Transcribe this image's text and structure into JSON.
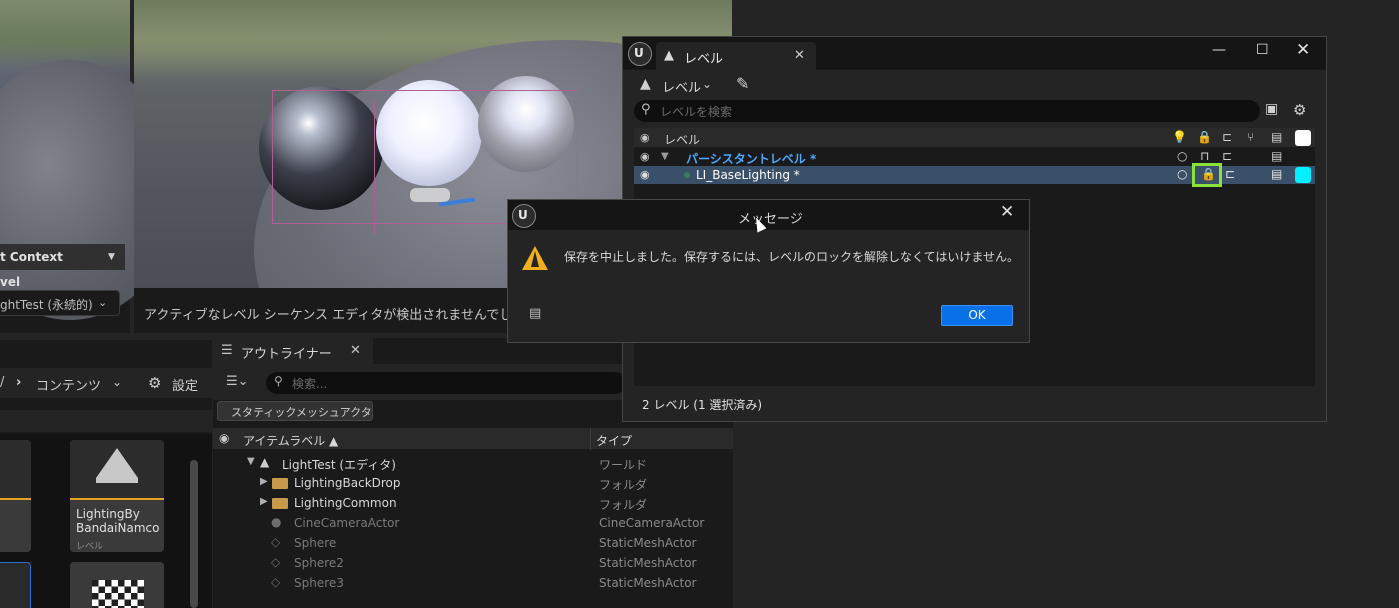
{
  "details_panel": {
    "context_label": "t Context",
    "level_label": "vel",
    "level_value": "ghtTest (永続的)"
  },
  "viewport": {
    "message": "アクティブなレベル シーケンス エディタが検出されませんでした。"
  },
  "content_browser": {
    "path_label": "コンテンツ",
    "settings_label": "設定",
    "assets": [
      {
        "name": "LightingBy BandaiNamco",
        "type": "レベル"
      }
    ]
  },
  "outliner": {
    "tab_label": "アウトライナー",
    "search_placeholder": "検索...",
    "filter_chip": "スタティックメッシュアクタ",
    "columns": {
      "label": "アイテムラベル ▲",
      "type": "タイプ"
    },
    "rows": [
      {
        "name": "LightTest (エディタ)",
        "type": "ワールド"
      },
      {
        "name": "LightingBackDrop",
        "type": "フォルダ"
      },
      {
        "name": "LightingCommon",
        "type": "フォルダ"
      },
      {
        "name": "CineCameraActor",
        "type": "CineCameraActor"
      },
      {
        "name": "Sphere",
        "type": "StaticMeshActor"
      },
      {
        "name": "Sphere2",
        "type": "StaticMeshActor"
      },
      {
        "name": "Sphere3",
        "type": "StaticMeshActor"
      }
    ]
  },
  "level_window": {
    "tab_label": "レベル",
    "levels_dropdown": "レベル",
    "search_placeholder": "レベルを検索",
    "header_label": "レベル",
    "rows": [
      {
        "name": "パーシスタントレベル *"
      },
      {
        "name": "LI_BaseLighting *"
      }
    ],
    "status": "2 レベル (1 選択済み)",
    "colors": {
      "persistent": "#ffffff",
      "selected": "#00f0ff",
      "lock_highlight": "#8ce03a"
    }
  },
  "dialog": {
    "title": "メッセージ",
    "message": "保存を中止しました。保存するには、レベルのロックを解除しなくてはいけません。",
    "ok_label": "OK"
  }
}
